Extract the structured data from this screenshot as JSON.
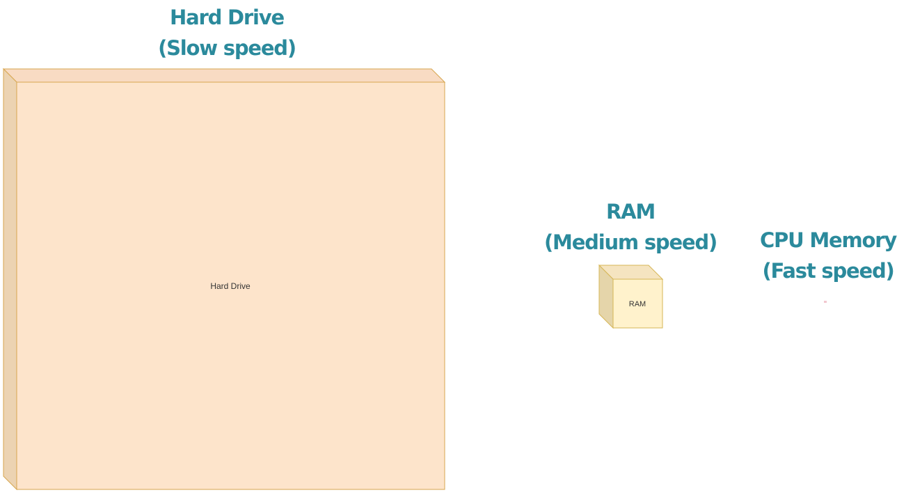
{
  "colors": {
    "caption_teal": "#2b8a9c",
    "hard_drive_face": "#fde4cb",
    "hard_drive_top": "#f8dbc3",
    "hard_drive_side": "#ecd3b2",
    "hard_drive_border": "#d7a64f",
    "ram_face": "#fff2cc",
    "ram_top": "#f5e4c0",
    "ram_side": "#e5d5aa",
    "ram_border": "#d6b656",
    "cpu_dot": "#f2c7cf"
  },
  "captions": {
    "hard_drive": {
      "title": "Hard Drive",
      "subtitle": "(Slow speed)"
    },
    "ram": {
      "title": "RAM",
      "subtitle": "(Medium speed)"
    },
    "cpu_memory": {
      "title": "CPU Memory",
      "subtitle": "(Fast speed)"
    }
  },
  "blocks": {
    "hard_drive": {
      "label": "Hard Drive"
    },
    "ram": {
      "label": "RAM"
    }
  }
}
